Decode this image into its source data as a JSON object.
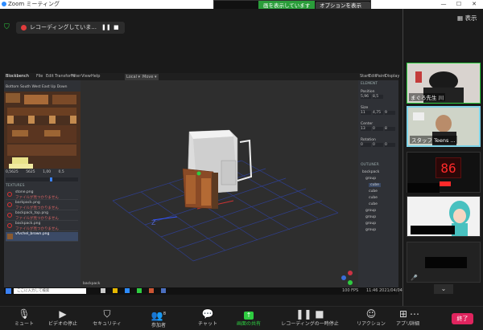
{
  "window": {
    "title": "Zoom ミーティング"
  },
  "share_bar": {
    "status": "画を表示しています",
    "options_label": "オプションを表示 ⌄"
  },
  "meeting_bar": {
    "recording_label": "レコーディングしていま...",
    "view_label": "表示"
  },
  "blockbench": {
    "app_name": "Blockbench",
    "menu_items": [
      "File",
      "Edit",
      "Transform",
      "Filter",
      "View",
      "Help"
    ],
    "left_tabs": [
      "Bottom",
      "South",
      "West",
      "East",
      "Up",
      "Down"
    ],
    "uv_values": [
      "0,5625",
      "5625",
      "1,00",
      "0,5"
    ],
    "textures_header": "TEXTURES",
    "textures": [
      {
        "name": "stone.png",
        "note": "ファイルが見つかりません"
      },
      {
        "name": "barkpack.png",
        "note": "ファイルが見つかりません"
      },
      {
        "name": "backpack_top.png",
        "note": "ファイルが見つかりません"
      },
      {
        "name": "backpack.png",
        "note": "ファイルが見つかりません"
      },
      {
        "name": "vfvchel_brown.png",
        "note": ""
      }
    ],
    "right_tabs": [
      "Start",
      "Edit",
      "Paint",
      "Display"
    ],
    "element_header": "ELEMENT",
    "property_labels": [
      "Position",
      "Size",
      "Center",
      "Rotation"
    ],
    "property_values": [
      [
        "5,96",
        "8,5",
        ""
      ],
      [
        "11",
        "4,75",
        "9"
      ],
      [
        "13",
        "0",
        "8"
      ],
      [
        "0",
        "0",
        "0"
      ]
    ],
    "outliner_header": "OUTLINER",
    "outliner_items": [
      "backpack",
      "group",
      "cube",
      "cube",
      "cube",
      "cube",
      "group",
      "group",
      "group",
      "group"
    ],
    "viewport_label": "Local ▾",
    "viewport_mode": "Move ▾",
    "bottom_tab": "backpack",
    "fps": "100 FPS"
  },
  "taskbar": {
    "search_placeholder": "ここに入力して検索",
    "time": "11:46",
    "date": "2021/04/04"
  },
  "participants": [
    {
      "name": "まぐろ先生 川"
    },
    {
      "name": "スタッフ Teens ..."
    },
    {
      "name": ""
    },
    {
      "name": ""
    },
    {
      "name": ""
    }
  ],
  "toolbar": {
    "items": [
      {
        "icon": "mic-icon",
        "label": "ミュート"
      },
      {
        "icon": "video-icon",
        "label": "ビデオの停止"
      },
      {
        "icon": "security-icon",
        "label": "セキュリティ"
      },
      {
        "icon": "participants-icon",
        "label": "参加者",
        "count": "8"
      },
      {
        "icon": "chat-icon",
        "label": "チャット"
      },
      {
        "icon": "share-icon",
        "label": "画面の共有"
      },
      {
        "icon": "record-icon",
        "label": "レコーディングの一時停止"
      },
      {
        "icon": "reaction-icon",
        "label": "リアクション"
      },
      {
        "icon": "apps-icon",
        "label": "アプリ"
      },
      {
        "icon": "more-icon",
        "label": "詳細"
      }
    ],
    "end_label": "終了"
  },
  "colors": {
    "share_green": "#2a9d3a",
    "end_red": "#e0245e",
    "active_border": "#7dd3e8"
  }
}
